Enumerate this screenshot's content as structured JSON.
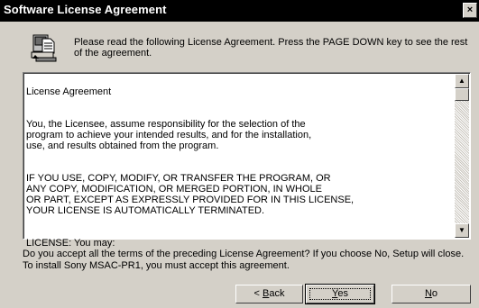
{
  "window": {
    "title": "Software License Agreement",
    "close_label": "×"
  },
  "header": {
    "icon": "setup-computer-icon",
    "instructions": "Please read the following License Agreement.  Press the PAGE DOWN key to see the rest of the agreement."
  },
  "license": {
    "paragraphs": [
      "License Agreement",
      "You, the Licensee, assume responsibility for the selection of the\nprogram to achieve your intended results, and for the installation,\nuse, and results obtained from the program.",
      "IF YOU USE, COPY, MODIFY, OR TRANSFER THE PROGRAM, OR\nANY COPY, MODIFICATION, OR MERGED PORTION, IN WHOLE\nOR PART, EXCEPT AS EXPRESSLY PROVIDED FOR IN THIS LICENSE,\nYOUR LICENSE IS AUTOMATICALLY TERMINATED.",
      "LICENSE: You may:"
    ]
  },
  "scrollbar": {
    "up_icon": "▲",
    "down_icon": "▼",
    "position": 0
  },
  "question": "Do you accept all the terms of the preceding License Agreement?  If you choose No,  Setup will close.  To install Sony MSAC-PR1, you must accept this agreement.",
  "buttons": {
    "back": {
      "prefix": "< ",
      "accel": "B",
      "rest": "ack"
    },
    "yes": {
      "accel": "Y",
      "rest": "es"
    },
    "no": {
      "accel": "N",
      "rest": "o"
    }
  }
}
